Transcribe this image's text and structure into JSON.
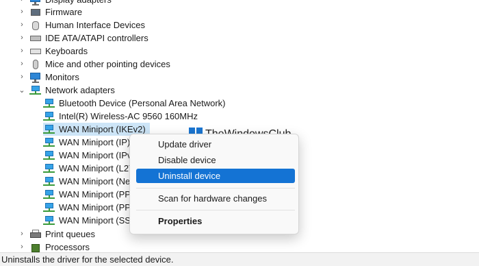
{
  "tree": {
    "display_adapters": "Display adapters",
    "firmware": "Firmware",
    "hid": "Human Interface Devices",
    "ide": "IDE ATA/ATAPI controllers",
    "keyboards": "Keyboards",
    "mice": "Mice and other pointing devices",
    "monitors": "Monitors",
    "network_adapters": "Network adapters",
    "network_children": [
      "Bluetooth Device (Personal Area Network)",
      "Intel(R) Wireless-AC 9560 160MHz",
      "WAN Miniport (IKEv2)",
      "WAN Miniport (IP)",
      "WAN Miniport (IPv",
      "WAN Miniport (L2T",
      "WAN Miniport (Ne",
      "WAN Miniport (PPP",
      "WAN Miniport (PPT",
      "WAN Miniport (SST"
    ],
    "print_queues": "Print queues",
    "processors": "Processors"
  },
  "watermark": "TheWindowsClub",
  "context_menu": {
    "update_driver": "Update driver",
    "disable_device": "Disable device",
    "uninstall_device": "Uninstall device",
    "scan_changes": "Scan for hardware changes",
    "properties": "Properties"
  },
  "status_bar": "Uninstalls the driver for the selected device."
}
